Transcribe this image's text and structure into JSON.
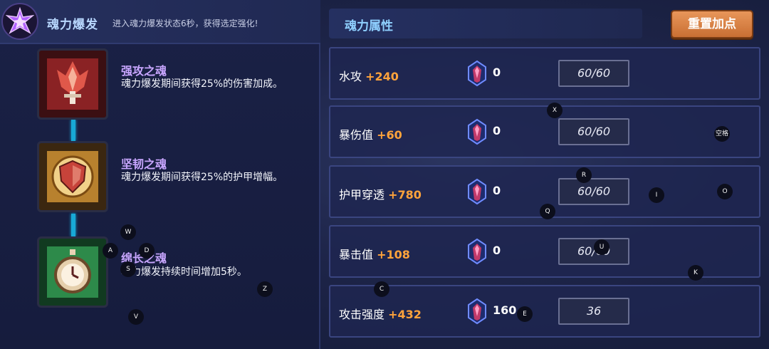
{
  "left_panel": {
    "title": "魂力爆发",
    "description": "进入魂力爆发状态6秒，获得选定强化!",
    "skills": [
      {
        "name": "强攻之魂",
        "text": "魂力爆发期间获得25%的伤害加成。",
        "color": "#7a1c1c"
      },
      {
        "name": "坚韧之魂",
        "text": "魂力爆发期间获得25%的护甲增幅。",
        "color": "#8b5b21"
      },
      {
        "name": "绵长之魂",
        "text": "魂力爆发持续时间增加5秒。",
        "color": "#1f6b3a"
      }
    ]
  },
  "right_panel": {
    "title": "魂力属性",
    "reset_label": "重置加点",
    "stats": [
      {
        "label": "水攻",
        "bonus": "+240",
        "count": "0",
        "value": "60/60"
      },
      {
        "label": "暴伤值",
        "bonus": "+60",
        "count": "0",
        "value": "60/60"
      },
      {
        "label": "护甲穿透",
        "bonus": "+780",
        "count": "0",
        "value": "60/60"
      },
      {
        "label": "暴击值",
        "bonus": "+108",
        "count": "0",
        "value": "60/60"
      },
      {
        "label": "攻击强度",
        "bonus": "+432",
        "count": "160",
        "value": "36"
      }
    ]
  },
  "key_hints": [
    "X",
    "空格",
    "R",
    "I",
    "O",
    "Q",
    "W",
    "A",
    "D",
    "S",
    "U",
    "K",
    "C",
    "Z",
    "V",
    "E"
  ],
  "colors": {
    "accent": "#ffa33b",
    "title_blue": "#8fd0ff",
    "skill_name": "#c8a6ff",
    "connector": "#18a9d6"
  }
}
